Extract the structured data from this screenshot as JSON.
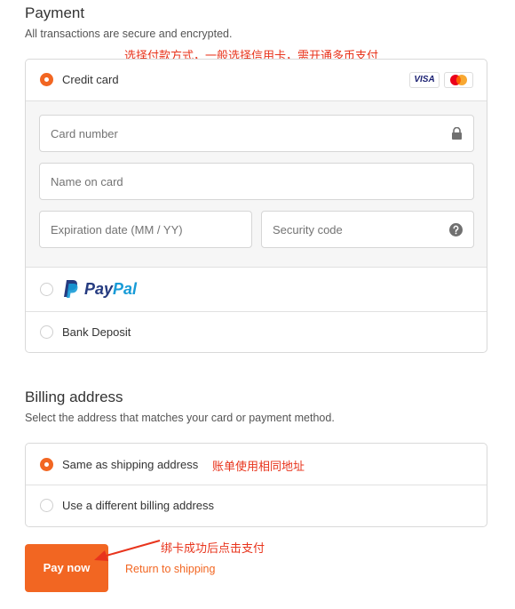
{
  "payment": {
    "title": "Payment",
    "subtitle": "All transactions are secure and encrypted.",
    "note": "选择付款方式，一般选择信用卡，需开通多币支付",
    "credit_card": {
      "label": "Credit card",
      "selected": true,
      "brands": [
        "VISA",
        "Mastercard"
      ],
      "visa_text": "VISA",
      "card_number_placeholder": "Card number",
      "name_placeholder": "Name on card",
      "expiry_placeholder": "Expiration date (MM / YY)",
      "security_placeholder": "Security code"
    },
    "paypal": {
      "label_pay": "Pay",
      "label_pal": "Pal",
      "selected": false
    },
    "bank_deposit": {
      "label": "Bank Deposit",
      "selected": false
    }
  },
  "billing": {
    "title": "Billing address",
    "subtitle": "Select the address that matches your card or payment method.",
    "same_label": "Same as shipping address",
    "same_note": "账单使用相同地址",
    "different_label": "Use a different billing address",
    "selected": "same"
  },
  "actions": {
    "pay_now": "Pay now",
    "return_link": "Return to shipping",
    "note": "绑卡成功后点击支付"
  },
  "colors": {
    "accent": "#f26622",
    "annotation": "#e8341c",
    "paypal_dark": "#253b80",
    "paypal_light": "#179bd7"
  },
  "icons": [
    "lock-icon",
    "help-circle-icon",
    "paypal-logo-icon",
    "mastercard-icon",
    "visa-icon",
    "annotation-arrow-icon"
  ]
}
